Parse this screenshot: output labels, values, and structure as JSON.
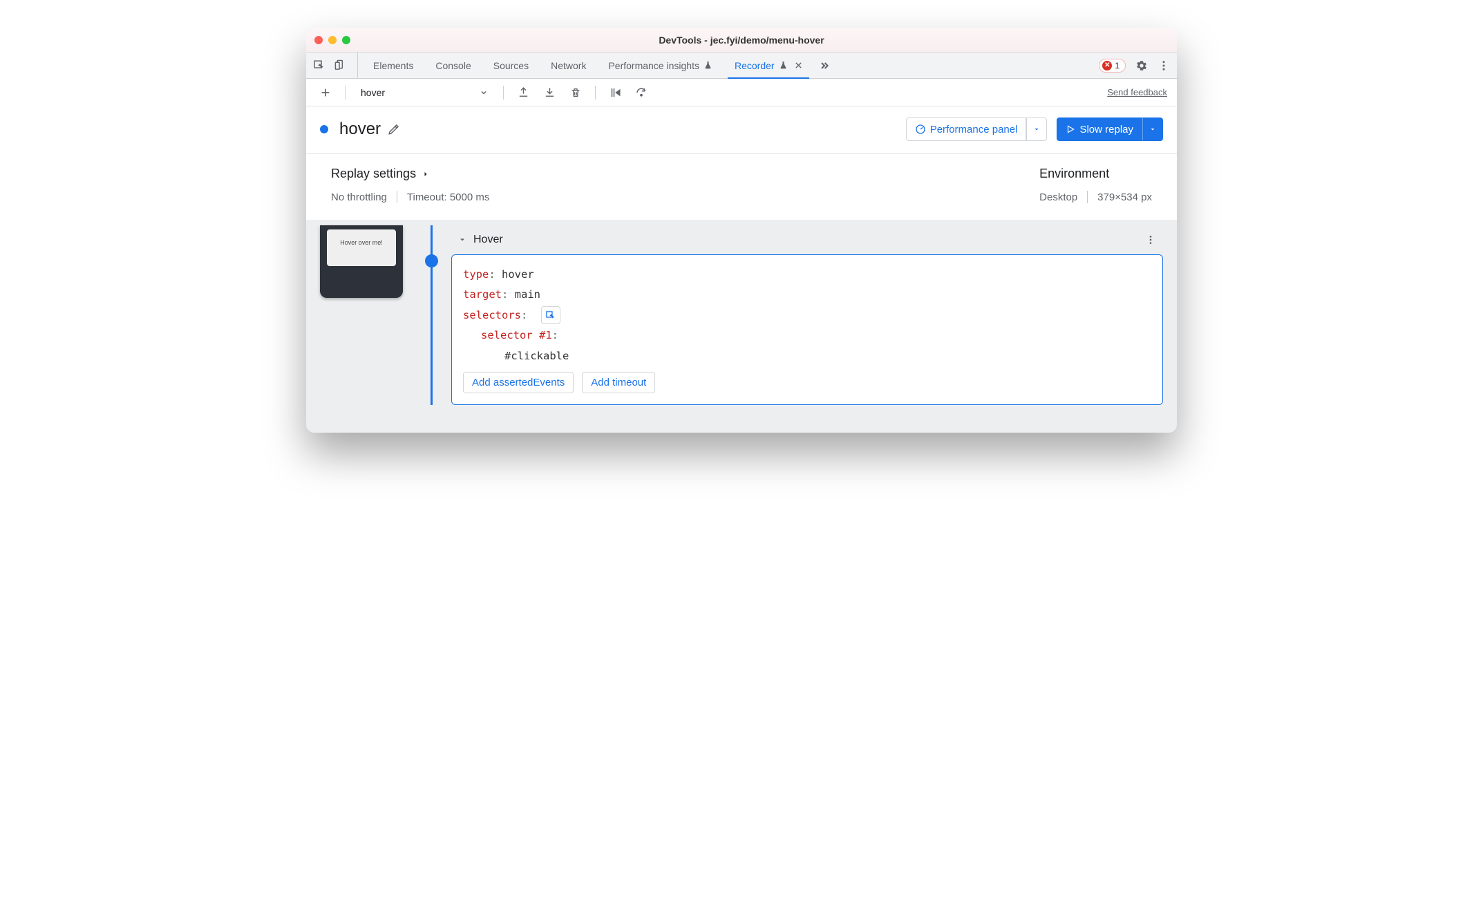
{
  "window": {
    "title": "DevTools - jec.fyi/demo/menu-hover"
  },
  "tabs": {
    "items": [
      "Elements",
      "Console",
      "Sources",
      "Network",
      "Performance insights",
      "Recorder"
    ],
    "active": "Recorder",
    "error_count": "1"
  },
  "toolbar": {
    "selected_recording": "hover",
    "send_feedback": "Send feedback"
  },
  "recording": {
    "title": "hover",
    "perf_panel_btn": "Performance panel",
    "replay_btn": "Slow replay"
  },
  "settings": {
    "replay_title": "Replay settings",
    "throttling": "No throttling",
    "timeout": "Timeout: 5000 ms",
    "environment_title": "Environment",
    "device": "Desktop",
    "viewport": "379×534 px"
  },
  "thumbnail": {
    "text": "Hover over me!"
  },
  "step": {
    "title": "Hover",
    "rows": {
      "type_key": "type",
      "type_val": "hover",
      "target_key": "target",
      "target_val": "main",
      "selectors_key": "selectors",
      "selector1_key": "selector #1",
      "selector1_val": "#clickable"
    },
    "add_asserted": "Add assertedEvents",
    "add_timeout": "Add timeout"
  }
}
